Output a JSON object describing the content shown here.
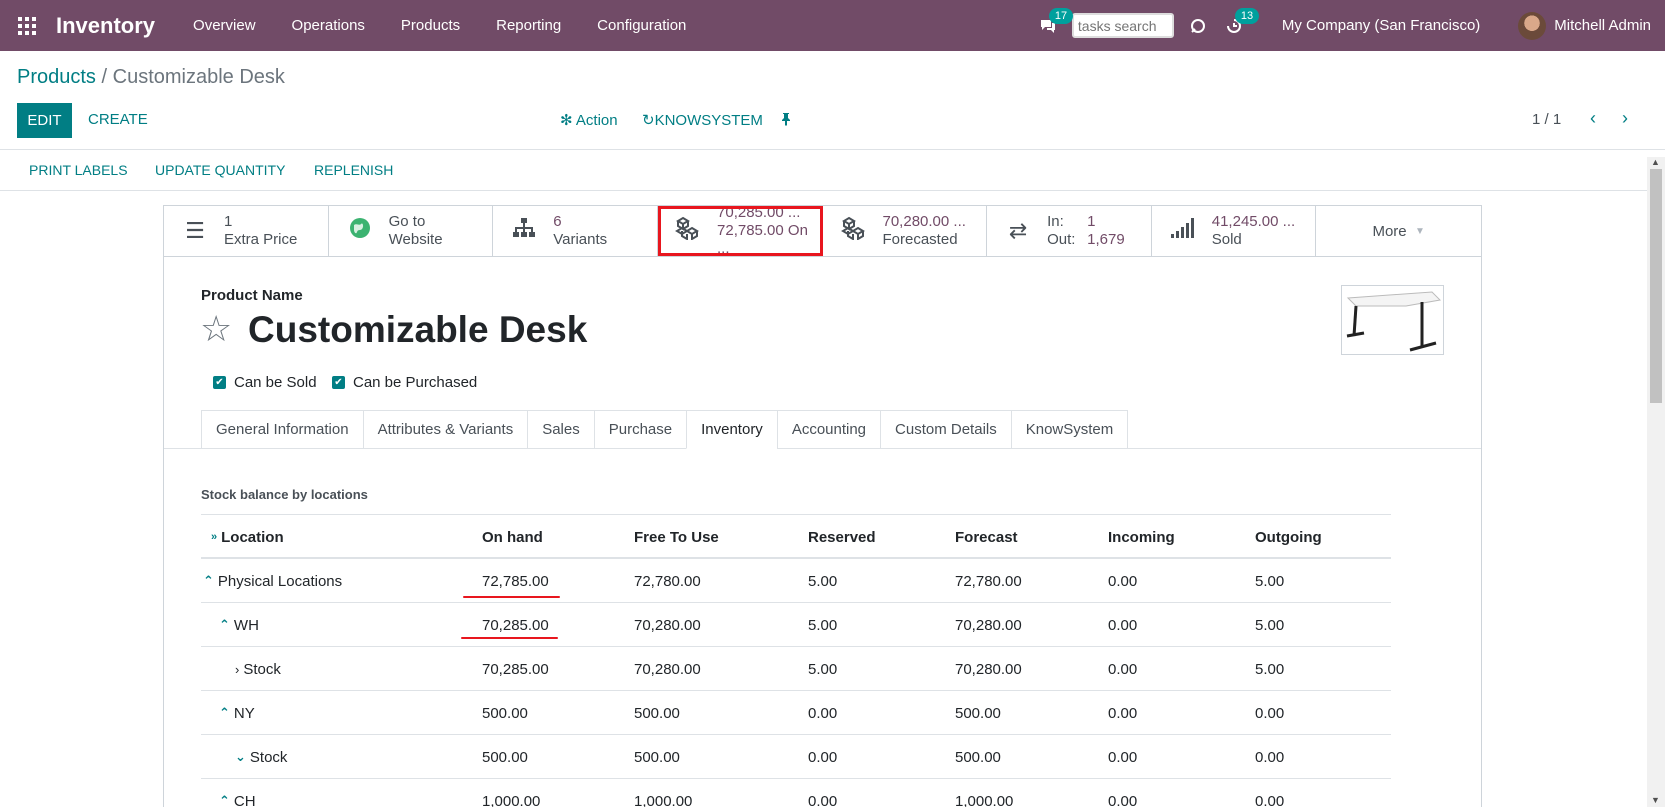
{
  "navbar": {
    "app_name": "Inventory",
    "menus": [
      "Overview",
      "Operations",
      "Products",
      "Reporting",
      "Configuration"
    ],
    "chat_count": "17",
    "search_placeholder": "tasks search",
    "activity_count": "13",
    "company": "My Company (San Francisco)",
    "user": "Mitchell Admin",
    "accent_color": "#714b67"
  },
  "control_panel": {
    "breadcrumb_parent": "Products",
    "breadcrumb_separator": "/",
    "breadcrumb_current": "Customizable Desk",
    "edit_label": "EDIT",
    "create_label": "CREATE",
    "action_label": "Action",
    "knowsystem_label": "KNOWSYSTEM",
    "pager": "1 / 1"
  },
  "statusbar": {
    "buttons": [
      "PRINT LABELS",
      "UPDATE QUANTITY",
      "REPLENISH"
    ]
  },
  "smart_buttons": {
    "extra_price": {
      "value": "1",
      "label": "Extra Price",
      "icon": "list-icon"
    },
    "website": {
      "value": "Go to",
      "label": "Website",
      "icon": "globe-icon"
    },
    "variants": {
      "value": "6",
      "label": "Variants",
      "icon": "sitemap-icon"
    },
    "on_hand": {
      "value": "70,285.00 ...",
      "label": "72,785.00 On ...",
      "icon": "cubes-icon"
    },
    "forecasted": {
      "value": "70,280.00 ...",
      "label": "Forecasted",
      "icon": "cubes-icon"
    },
    "in_out": {
      "in_label": "In:",
      "in_value": "1",
      "out_label": "Out:",
      "out_value": "1,679",
      "icon": "exchange-icon"
    },
    "sold": {
      "value": "41,245.00 ...",
      "label": "Sold",
      "icon": "signal-icon"
    },
    "more": "More"
  },
  "form": {
    "product_name_label": "Product Name",
    "product_name": "Customizable Desk",
    "can_be_sold": "Can be Sold",
    "can_be_purchased": "Can be Purchased"
  },
  "tabs": [
    "General Information",
    "Attributes & Variants",
    "Sales",
    "Purchase",
    "Inventory",
    "Accounting",
    "Custom Details",
    "KnowSystem"
  ],
  "active_tab": "Inventory",
  "stock": {
    "section_label": "Stock balance by locations",
    "headers": [
      "Location",
      "On hand",
      "Free To Use",
      "Reserved",
      "Forecast",
      "Incoming",
      "Outgoing"
    ],
    "rows": [
      {
        "chevron": "⌃",
        "location": "Physical Locations",
        "on_hand": "72,785.00",
        "free": "72,780.00",
        "reserved": "5.00",
        "forecast": "72,780.00",
        "incoming": "0.00",
        "outgoing": "5.00"
      },
      {
        "chevron": "⌃",
        "location": "WH",
        "on_hand": "70,285.00",
        "free": "70,280.00",
        "reserved": "5.00",
        "forecast": "70,280.00",
        "incoming": "0.00",
        "outgoing": "5.00"
      },
      {
        "chevron": "›",
        "location": "Stock",
        "on_hand": "70,285.00",
        "free": "70,280.00",
        "reserved": "5.00",
        "forecast": "70,280.00",
        "incoming": "0.00",
        "outgoing": "5.00"
      },
      {
        "chevron": "⌃",
        "location": "NY",
        "on_hand": "500.00",
        "free": "500.00",
        "reserved": "0.00",
        "forecast": "500.00",
        "incoming": "0.00",
        "outgoing": "0.00"
      },
      {
        "chevron": "⌄",
        "location": "Stock",
        "on_hand": "500.00",
        "free": "500.00",
        "reserved": "0.00",
        "forecast": "500.00",
        "incoming": "0.00",
        "outgoing": "0.00"
      },
      {
        "chevron": "⌃",
        "location": "CH",
        "on_hand": "1,000.00",
        "free": "1,000.00",
        "reserved": "0.00",
        "forecast": "1,000.00",
        "incoming": "0.00",
        "outgoing": "0.00"
      }
    ]
  }
}
